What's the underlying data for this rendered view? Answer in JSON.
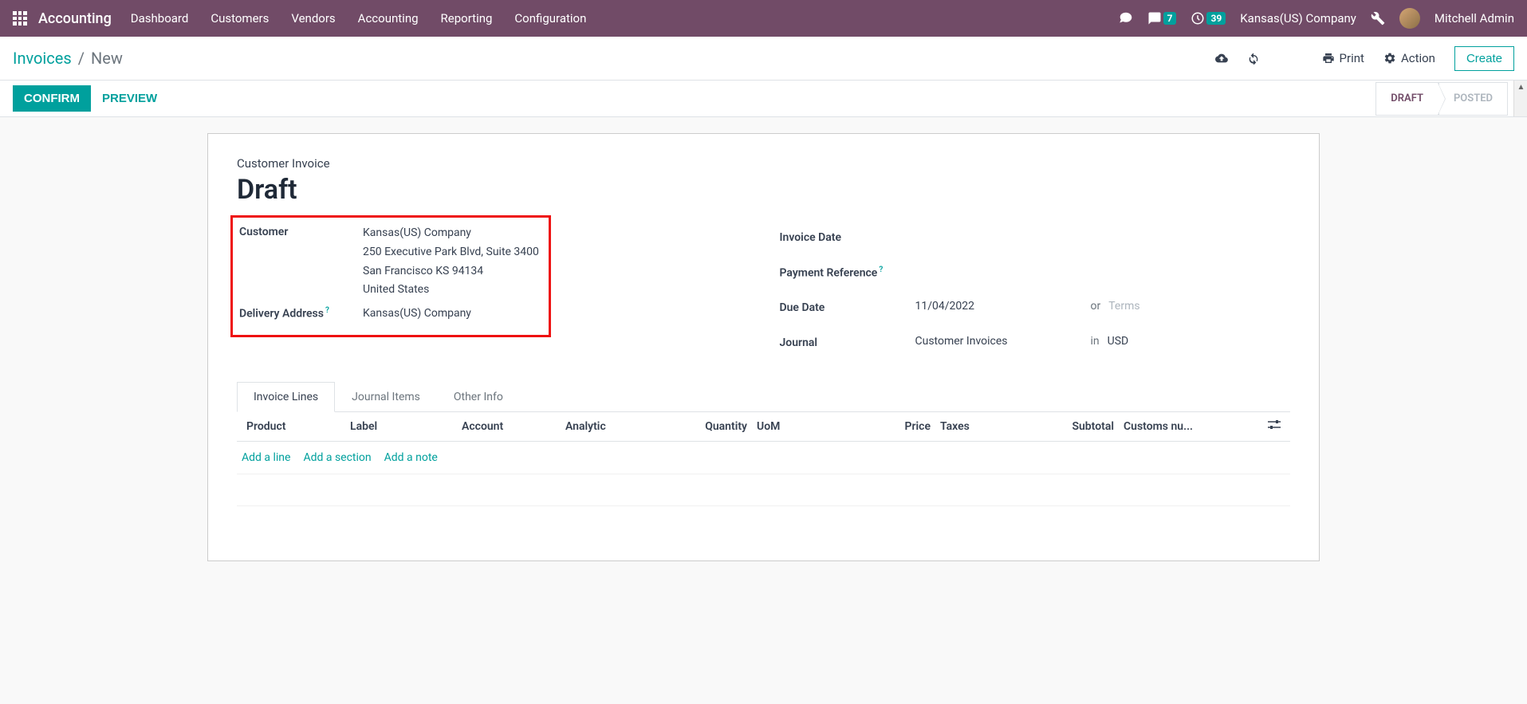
{
  "nav": {
    "brand": "Accounting",
    "items": [
      "Dashboard",
      "Customers",
      "Vendors",
      "Accounting",
      "Reporting",
      "Configuration"
    ],
    "chat_badge": "7",
    "activity_badge": "39",
    "company": "Kansas(US) Company",
    "user": "Mitchell Admin"
  },
  "breadcrumb": {
    "parent": "Invoices",
    "current": "New",
    "print": "Print",
    "action": "Action",
    "create": "Create"
  },
  "buttons": {
    "confirm": "CONFIRM",
    "preview": "PREVIEW"
  },
  "status": {
    "draft": "DRAFT",
    "posted": "POSTED"
  },
  "sheet": {
    "label": "Customer Invoice",
    "title": "Draft"
  },
  "left": {
    "customer_label": "Customer",
    "customer_name": "Kansas(US) Company",
    "customer_addr1": "250 Executive Park Blvd, Suite 3400",
    "customer_addr2": "San Francisco KS 94134",
    "customer_addr3": "United States",
    "delivery_label": "Delivery Address",
    "delivery_value": "Kansas(US) Company"
  },
  "right": {
    "invoice_date_label": "Invoice Date",
    "payment_ref_label": "Payment Reference",
    "due_date_label": "Due Date",
    "due_date_value": "11/04/2022",
    "or_text": "or",
    "terms_placeholder": "Terms",
    "journal_label": "Journal",
    "journal_value": "Customer Invoices",
    "in_text": "in",
    "currency": "USD"
  },
  "tabs": [
    "Invoice Lines",
    "Journal Items",
    "Other Info"
  ],
  "columns": {
    "product": "Product",
    "label": "Label",
    "account": "Account",
    "analytic": "Analytic",
    "quantity": "Quantity",
    "uom": "UoM",
    "price": "Price",
    "taxes": "Taxes",
    "subtotal": "Subtotal",
    "customs": "Customs nu..."
  },
  "actions": {
    "add_line": "Add a line",
    "add_section": "Add a section",
    "add_note": "Add a note"
  }
}
